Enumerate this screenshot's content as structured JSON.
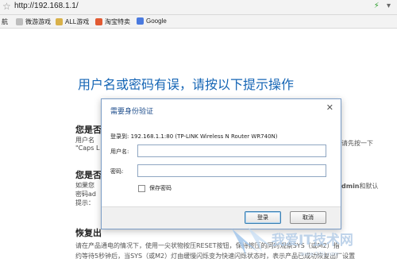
{
  "browser": {
    "url": "http://192.168.1.1/",
    "bookmarks": [
      {
        "label": "航",
        "icon": "bookmark-icon",
        "color": "#e8a23a"
      },
      {
        "label": "微游游戏",
        "icon": "game-icon",
        "color": "#999999"
      },
      {
        "label": "ALL游戏",
        "icon": "game-icon",
        "color": "#c9a23a"
      },
      {
        "label": "淘宝特卖",
        "icon": "shopping-icon",
        "color": "#e04a2a"
      },
      {
        "label": "Google",
        "icon": "google-icon",
        "color": "#4a7adf"
      }
    ]
  },
  "page": {
    "heading": "用户名或密码有误，请按以下提示操作",
    "sections": [
      {
        "title": "您是否",
        "text1": "用户名",
        "text2": "\"Caps L",
        "right": "请先按一下"
      },
      {
        "title": "您是否",
        "text1": "如果您",
        "text2": "密码ad",
        "text3": "提示：",
        "right_bold": "dmin",
        "right": "和默认"
      },
      {
        "title": "恢复出",
        "text1": "请在产品通电的情况下，使用一尖状物按压RESET按钮，保持按压的同时观察SYS（或M2）指",
        "text2": "约等待5秒钟后，当SYS（或M2）灯由缓慢闪烁变为快速闪烁状态时，表示产品已成功恢复出厂设置"
      }
    ]
  },
  "dialog": {
    "title": "需要身份验证",
    "host_line": "登录到:   192.168.1.1:80 (TP-LINK Wireless N Router WR740N)",
    "username_label": "用户名:",
    "username_value": "",
    "password_label": "密码:",
    "password_value": "",
    "remember_label": "保存密码",
    "ok_label": "登录",
    "cancel_label": "取消"
  },
  "watermark": {
    "text": "我爱IT技术网",
    "sub": "www.52ij.com"
  }
}
